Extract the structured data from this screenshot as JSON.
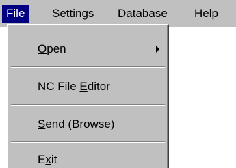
{
  "menubar": {
    "items": [
      {
        "pre": "",
        "key": "F",
        "post": "ile"
      },
      {
        "pre": "",
        "key": "S",
        "post": "ettings"
      },
      {
        "pre": "",
        "key": "D",
        "post": "atabase"
      },
      {
        "pre": "",
        "key": "H",
        "post": "elp"
      }
    ]
  },
  "file_menu": {
    "items": [
      {
        "pre": "",
        "key": "O",
        "post": "pen",
        "submenu_icon": "submenu-arrow-icon"
      },
      {
        "pre": "NC File ",
        "key": "E",
        "post": "ditor"
      },
      {
        "pre": "",
        "key": "S",
        "post": "end (Browse)"
      },
      {
        "pre": "E",
        "key": "x",
        "post": "it"
      }
    ]
  },
  "colors": {
    "menu_bg": "#c0c0c0",
    "highlight_bg": "#000080",
    "highlight_text": "#ffffff"
  }
}
